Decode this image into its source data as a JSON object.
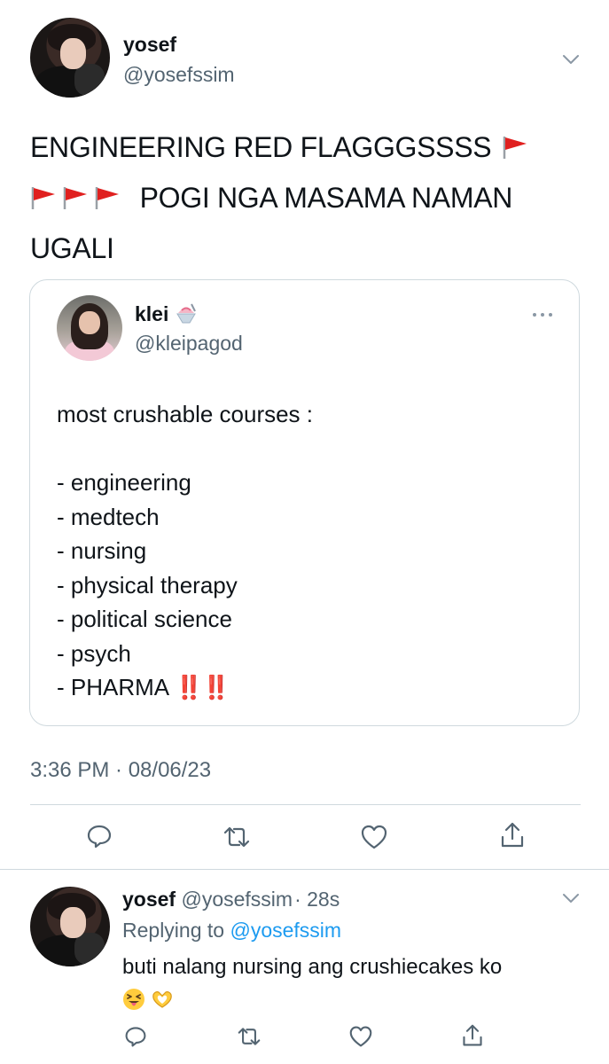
{
  "main_tweet": {
    "author_name": "yosef",
    "author_handle": "@yosefssim",
    "text_line1": "ENGINEERING RED FLAGGGSSSS",
    "text_line2": "POGI NGA MASAMA NAMAN",
    "text_line3": "UGALI",
    "timestamp": "3:36 PM · 08/06/23"
  },
  "quoted_tweet": {
    "author_name": "klei",
    "author_handle": "@kleipagod",
    "lines": [
      "most crushable courses :",
      "",
      "- engineering",
      "- medtech",
      "- nursing",
      "- physical therapy",
      "- political science",
      "- psych",
      "- PHARMA"
    ],
    "emphasis": "‼️‼️"
  },
  "reply_tweet": {
    "author_name": "yosef",
    "author_handle": "@yosefssim",
    "age": "· 28s",
    "replying_to_label": "Replying to",
    "replying_to_handle": "@yosefssim",
    "text": "buti nalang nursing ang crushiecakes ko"
  },
  "icons": {
    "reply": "reply-icon",
    "retweet": "retweet-icon",
    "like": "heart-icon",
    "share": "share-icon",
    "more": "chevron-down-icon",
    "quote_more": "more-dots-icon"
  },
  "colors": {
    "text": "#0f1419",
    "secondary": "#536471",
    "link": "#1d9bf0",
    "border": "#cfd9de",
    "flag_red": "#e0201f"
  }
}
